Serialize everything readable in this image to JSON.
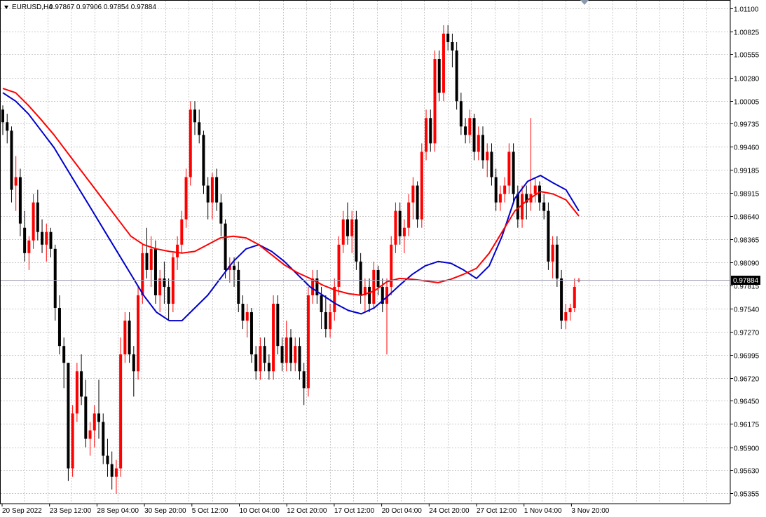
{
  "header": {
    "symbol_timeframe": "EURUSD,H4",
    "quote": "0.97867 0.97906 0.97854 0.97884"
  },
  "colors": {
    "bull_candle": "#ff0000",
    "bear_candle": "#000000",
    "ma_fast": "#0000cc",
    "ma_slow": "#ff0000",
    "grid": "#c8c8c8",
    "last_price_line": "#a0a0b4",
    "last_price_tag": "#000000"
  },
  "chart_data": {
    "type": "candlestick",
    "symbol": "EURUSD",
    "timeframe": "H4",
    "last_price": 0.97884,
    "ylim": [
      0.9524,
      1.0119
    ],
    "y_ticks": [
      "1.01100",
      "1.00825",
      "1.00555",
      "1.00280",
      "1.00005",
      "0.99735",
      "0.99460",
      "0.99185",
      "0.98915",
      "0.98640",
      "0.98365",
      "0.98090",
      "0.97815",
      "0.97540",
      "0.97270",
      "0.96995",
      "0.96720",
      "0.96450",
      "0.96175",
      "0.95900",
      "0.95630",
      "0.95355"
    ],
    "x_ticks": [
      "20 Sep 2022",
      "23 Sep 12:00",
      "28 Sep 04:00",
      "30 Sep 20:00",
      "5 Oct 12:00",
      "10 Oct 04:00",
      "12 Oct 20:00",
      "17 Oct 12:00",
      "20 Oct 04:00",
      "24 Oct 20:00",
      "27 Oct 12:00",
      "1 Nov 04:00",
      "3 Nov 20:00"
    ],
    "grid": true,
    "ohlc": [
      [
        0.999,
        0.9995,
        0.996,
        0.9975
      ],
      [
        0.9975,
        0.9985,
        0.995,
        0.9965
      ],
      [
        0.9965,
        0.997,
        0.988,
        0.9895
      ],
      [
        0.99,
        0.9935,
        0.987,
        0.991
      ],
      [
        0.991,
        0.992,
        0.984,
        0.9855
      ],
      [
        0.985,
        0.987,
        0.981,
        0.982
      ],
      [
        0.982,
        0.984,
        0.98,
        0.9835
      ],
      [
        0.9835,
        0.989,
        0.9825,
        0.988
      ],
      [
        0.988,
        0.9895,
        0.9835,
        0.9845
      ],
      [
        0.9845,
        0.986,
        0.982,
        0.983
      ],
      [
        0.983,
        0.9855,
        0.981,
        0.9845
      ],
      [
        0.9845,
        0.985,
        0.9815,
        0.9825
      ],
      [
        0.9825,
        0.983,
        0.974,
        0.9755
      ],
      [
        0.9755,
        0.977,
        0.97,
        0.971
      ],
      [
        0.971,
        0.972,
        0.966,
        0.969
      ],
      [
        0.969,
        0.969,
        0.955,
        0.9565
      ],
      [
        0.9565,
        0.964,
        0.9555,
        0.963
      ],
      [
        0.963,
        0.969,
        0.962,
        0.968
      ],
      [
        0.968,
        0.97,
        0.964,
        0.965
      ],
      [
        0.965,
        0.967,
        0.959,
        0.96
      ],
      [
        0.96,
        0.962,
        0.958,
        0.961
      ],
      [
        0.961,
        0.964,
        0.959,
        0.963
      ],
      [
        0.963,
        0.967,
        0.96,
        0.962
      ],
      [
        0.962,
        0.963,
        0.957,
        0.958
      ],
      [
        0.958,
        0.96,
        0.9555,
        0.957
      ],
      [
        0.957,
        0.9585,
        0.954,
        0.9555
      ],
      [
        0.9555,
        0.9575,
        0.9535,
        0.9565
      ],
      [
        0.9565,
        0.972,
        0.9555,
        0.97
      ],
      [
        0.97,
        0.975,
        0.969,
        0.974
      ],
      [
        0.974,
        0.975,
        0.969,
        0.97
      ],
      [
        0.97,
        0.971,
        0.965,
        0.968
      ],
      [
        0.968,
        0.978,
        0.967,
        0.977
      ],
      [
        0.977,
        0.983,
        0.976,
        0.982
      ],
      [
        0.982,
        0.985,
        0.979,
        0.98
      ],
      [
        0.98,
        0.984,
        0.978,
        0.9825
      ],
      [
        0.9825,
        0.9835,
        0.976,
        0.977
      ],
      [
        0.977,
        0.98,
        0.975,
        0.979
      ],
      [
        0.979,
        0.981,
        0.976,
        0.978
      ],
      [
        0.978,
        0.979,
        0.974,
        0.976
      ],
      [
        0.976,
        0.982,
        0.975,
        0.9815
      ],
      [
        0.9815,
        0.984,
        0.98,
        0.983
      ],
      [
        0.983,
        0.987,
        0.982,
        0.986
      ],
      [
        0.986,
        0.992,
        0.985,
        0.991
      ],
      [
        0.991,
        1.0,
        0.99,
        0.999
      ],
      [
        0.999,
        1.0,
        0.996,
        0.9975
      ],
      [
        0.9975,
        0.999,
        0.995,
        0.996
      ],
      [
        0.996,
        0.9965,
        0.989,
        0.99
      ],
      [
        0.99,
        0.991,
        0.986,
        0.988
      ],
      [
        0.988,
        0.9915,
        0.986,
        0.991
      ],
      [
        0.991,
        0.992,
        0.987,
        0.988
      ],
      [
        0.988,
        0.989,
        0.984,
        0.9855
      ],
      [
        0.9855,
        0.986,
        0.979,
        0.98
      ],
      [
        0.98,
        0.9815,
        0.9785,
        0.9805
      ],
      [
        0.9805,
        0.9815,
        0.978,
        0.98
      ],
      [
        0.98,
        0.981,
        0.975,
        0.976
      ],
      [
        0.976,
        0.977,
        0.973,
        0.974
      ],
      [
        0.974,
        0.976,
        0.972,
        0.975
      ],
      [
        0.975,
        0.9755,
        0.969,
        0.97
      ],
      [
        0.97,
        0.971,
        0.967,
        0.968
      ],
      [
        0.968,
        0.972,
        0.967,
        0.971
      ],
      [
        0.971,
        0.972,
        0.968,
        0.969
      ],
      [
        0.969,
        0.97,
        0.967,
        0.968
      ],
      [
        0.968,
        0.977,
        0.967,
        0.976
      ],
      [
        0.976,
        0.977,
        0.97,
        0.971
      ],
      [
        0.971,
        0.972,
        0.968,
        0.969
      ],
      [
        0.969,
        0.974,
        0.968,
        0.972
      ],
      [
        0.972,
        0.973,
        0.968,
        0.969
      ],
      [
        0.969,
        0.972,
        0.968,
        0.971
      ],
      [
        0.971,
        0.972,
        0.967,
        0.968
      ],
      [
        0.968,
        0.969,
        0.964,
        0.966
      ],
      [
        0.966,
        0.978,
        0.965,
        0.977
      ],
      [
        0.977,
        0.98,
        0.976,
        0.979
      ],
      [
        0.979,
        0.98,
        0.976,
        0.977
      ],
      [
        0.977,
        0.978,
        0.973,
        0.975
      ],
      [
        0.975,
        0.977,
        0.972,
        0.973
      ],
      [
        0.973,
        0.976,
        0.972,
        0.975
      ],
      [
        0.975,
        0.979,
        0.974,
        0.978
      ],
      [
        0.978,
        0.984,
        0.977,
        0.983
      ],
      [
        0.983,
        0.987,
        0.982,
        0.986
      ],
      [
        0.986,
        0.988,
        0.983,
        0.984
      ],
      [
        0.984,
        0.987,
        0.982,
        0.986
      ],
      [
        0.986,
        0.987,
        0.98,
        0.981
      ],
      [
        0.981,
        0.982,
        0.976,
        0.977
      ],
      [
        0.977,
        0.979,
        0.975,
        0.978
      ],
      [
        0.978,
        0.979,
        0.975,
        0.976
      ],
      [
        0.976,
        0.981,
        0.9755,
        0.98
      ],
      [
        0.98,
        0.9805,
        0.977,
        0.978
      ],
      [
        0.978,
        0.979,
        0.975,
        0.976
      ],
      [
        0.976,
        0.979,
        0.97,
        0.978
      ],
      [
        0.978,
        0.984,
        0.977,
        0.983
      ],
      [
        0.983,
        0.988,
        0.982,
        0.987
      ],
      [
        0.987,
        0.988,
        0.983,
        0.984
      ],
      [
        0.984,
        0.986,
        0.982,
        0.985
      ],
      [
        0.985,
        0.989,
        0.984,
        0.988
      ],
      [
        0.988,
        0.991,
        0.986,
        0.99
      ],
      [
        0.99,
        0.9905,
        0.985,
        0.986
      ],
      [
        0.986,
        0.995,
        0.985,
        0.994
      ],
      [
        0.994,
        0.999,
        0.993,
        0.998
      ],
      [
        0.998,
        0.999,
        0.994,
        0.995
      ],
      [
        0.995,
        1.006,
        0.994,
        1.005
      ],
      [
        1.005,
        1.006,
        1.0,
        1.001
      ],
      [
        1.001,
        1.009,
        1.0,
        1.008
      ],
      [
        1.008,
        1.009,
        1.006,
        1.007
      ],
      [
        1.007,
        1.008,
        1.004,
        1.006
      ],
      [
        1.006,
        1.007,
        0.999,
        1.0
      ],
      [
        1.0,
        1.001,
        0.996,
        0.997
      ],
      [
        0.997,
        0.998,
        0.995,
        0.996
      ],
      [
        0.996,
        0.999,
        0.995,
        0.998
      ],
      [
        0.998,
        0.9985,
        0.993,
        0.994
      ],
      [
        0.994,
        0.997,
        0.993,
        0.996
      ],
      [
        0.996,
        0.997,
        0.992,
        0.993
      ],
      [
        0.993,
        0.995,
        0.991,
        0.994
      ],
      [
        0.994,
        0.995,
        0.99,
        0.991
      ],
      [
        0.991,
        0.992,
        0.987,
        0.988
      ],
      [
        0.988,
        0.99,
        0.987,
        0.989
      ],
      [
        0.989,
        0.991,
        0.988,
        0.99
      ],
      [
        0.99,
        0.995,
        0.989,
        0.994
      ],
      [
        0.994,
        0.995,
        0.988,
        0.989
      ],
      [
        0.989,
        0.99,
        0.985,
        0.986
      ],
      [
        0.986,
        0.99,
        0.985,
        0.989
      ],
      [
        0.989,
        0.99,
        0.986,
        0.988
      ],
      [
        0.988,
        0.998,
        0.987,
        0.989
      ],
      [
        0.989,
        0.991,
        0.988,
        0.99
      ],
      [
        0.99,
        0.9905,
        0.987,
        0.988
      ],
      [
        0.988,
        0.989,
        0.986,
        0.987
      ],
      [
        0.987,
        0.988,
        0.98,
        0.981
      ],
      [
        0.981,
        0.984,
        0.979,
        0.983
      ],
      [
        0.983,
        0.984,
        0.978,
        0.979
      ],
      [
        0.979,
        0.98,
        0.973,
        0.974
      ],
      [
        0.974,
        0.976,
        0.973,
        0.975
      ],
      [
        0.975,
        0.976,
        0.974,
        0.9755
      ],
      [
        0.9755,
        0.979,
        0.975,
        0.978
      ],
      [
        0.97867,
        0.97906,
        0.97854,
        0.97884
      ]
    ],
    "series": [
      {
        "name": "",
        "color": "#0000cc",
        "values": [
          1.001,
          1.0,
          0.9985,
          0.9965,
          0.9945,
          0.992,
          0.9895,
          0.987,
          0.9845,
          0.982,
          0.9795,
          0.977,
          0.975,
          0.974,
          0.974,
          0.9755,
          0.977,
          0.979,
          0.981,
          0.9825,
          0.983,
          0.9822,
          0.981,
          0.9795,
          0.978,
          0.977,
          0.976,
          0.9752,
          0.9748,
          0.9755,
          0.9768,
          0.9782,
          0.9795,
          0.9805,
          0.981,
          0.9808,
          0.98,
          0.979,
          0.9805,
          0.984,
          0.9885,
          0.9905,
          0.9912,
          0.9903,
          0.9895,
          0.987
        ]
      },
      {
        "name": "",
        "color": "#ff0000",
        "values": [
          1.0015,
          1.001,
          0.9995,
          0.9978,
          0.996,
          0.994,
          0.992,
          0.99,
          0.988,
          0.986,
          0.984,
          0.983,
          0.9825,
          0.9822,
          0.982,
          0.9822,
          0.983,
          0.9838,
          0.984,
          0.9838,
          0.983,
          0.9818,
          0.9806,
          0.9797,
          0.979,
          0.9782,
          0.9776,
          0.9772,
          0.977,
          0.9775,
          0.9786,
          0.979,
          0.9789,
          0.9787,
          0.9785,
          0.9789,
          0.9795,
          0.9802,
          0.982,
          0.9845,
          0.987,
          0.9883,
          0.9893,
          0.989,
          0.9883,
          0.9864
        ]
      }
    ]
  }
}
